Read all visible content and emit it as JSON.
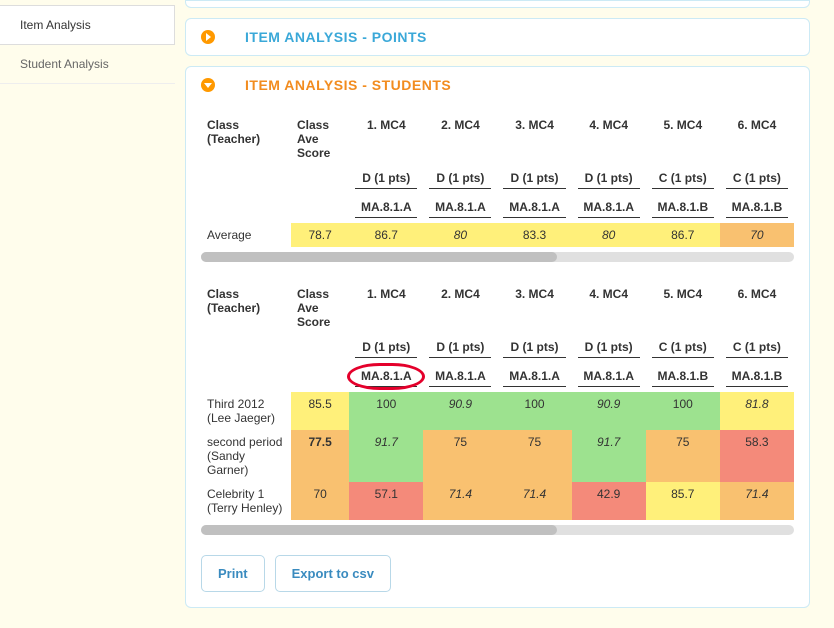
{
  "sidebar": {
    "items": [
      {
        "label": "Item Analysis",
        "active": true
      },
      {
        "label": "Student Analysis",
        "active": false
      }
    ]
  },
  "panels": {
    "points": {
      "title": "ITEM ANALYSIS - POINTS"
    },
    "students": {
      "title": "ITEM ANALYSIS - STUDENTS"
    }
  },
  "headers": {
    "class": "Class (Teacher)",
    "avg_score": "Class Ave Score",
    "questions": [
      {
        "num": "1. MC4",
        "key": "D (1 pts)",
        "std": "MA.8.1.A"
      },
      {
        "num": "2. MC4",
        "key": "D (1 pts)",
        "std": "MA.8.1.A"
      },
      {
        "num": "3. MC4",
        "key": "D (1 pts)",
        "std": "MA.8.1.A"
      },
      {
        "num": "4. MC4",
        "key": "D (1 pts)",
        "std": "MA.8.1.A"
      },
      {
        "num": "5. MC4",
        "key": "C (1 pts)",
        "std": "MA.8.1.B"
      },
      {
        "num": "6. MC4",
        "key": "C (1 pts)",
        "std": "MA.8.1.B"
      }
    ]
  },
  "table1": {
    "average_label": "Average",
    "average_score": "78.7",
    "average_vals": [
      {
        "v": "86.7",
        "h": "heat-y",
        "bold": true,
        "italic": false
      },
      {
        "v": "80",
        "h": "heat-y",
        "bold": false,
        "italic": true
      },
      {
        "v": "83.3",
        "h": "heat-y",
        "bold": false,
        "italic": false
      },
      {
        "v": "80",
        "h": "heat-y",
        "bold": false,
        "italic": true
      },
      {
        "v": "86.7",
        "h": "heat-y",
        "bold": false,
        "italic": false
      },
      {
        "v": "70",
        "h": "heat-o",
        "bold": false,
        "italic": true
      }
    ]
  },
  "table2": {
    "rows": [
      {
        "class": "Third 2012 (Lee Jaeger)",
        "score": "85.5",
        "score_h": "heat-y",
        "score_bold": false,
        "vals": [
          {
            "v": "100",
            "h": "heat-g",
            "italic": false
          },
          {
            "v": "90.9",
            "h": "heat-g",
            "italic": true
          },
          {
            "v": "100",
            "h": "heat-g",
            "italic": false
          },
          {
            "v": "90.9",
            "h": "heat-g",
            "italic": true
          },
          {
            "v": "100",
            "h": "heat-g",
            "italic": false
          },
          {
            "v": "81.8",
            "h": "heat-y",
            "italic": true
          }
        ]
      },
      {
        "class": "second period (Sandy Garner)",
        "score": "77.5",
        "score_h": "heat-o",
        "score_bold": true,
        "vals": [
          {
            "v": "91.7",
            "h": "heat-g",
            "italic": true
          },
          {
            "v": "75",
            "h": "heat-o",
            "italic": false
          },
          {
            "v": "75",
            "h": "heat-o",
            "italic": false
          },
          {
            "v": "91.7",
            "h": "heat-g",
            "italic": true
          },
          {
            "v": "75",
            "h": "heat-o",
            "italic": false
          },
          {
            "v": "58.3",
            "h": "heat-r",
            "italic": false
          }
        ]
      },
      {
        "class": "Celebrity 1 (Terry Henley)",
        "score": "70",
        "score_h": "heat-o",
        "score_bold": false,
        "vals": [
          {
            "v": "57.1",
            "h": "heat-r",
            "italic": false
          },
          {
            "v": "71.4",
            "h": "heat-o",
            "italic": true
          },
          {
            "v": "71.4",
            "h": "heat-o",
            "italic": true
          },
          {
            "v": "42.9",
            "h": "heat-r",
            "italic": false
          },
          {
            "v": "85.7",
            "h": "heat-y",
            "italic": false
          },
          {
            "v": "71.4",
            "h": "heat-o",
            "italic": true
          }
        ]
      }
    ]
  },
  "buttons": {
    "print": "Print",
    "export": "Export to csv"
  },
  "circled": {
    "table": 2,
    "row": "header_std",
    "col": 0
  }
}
